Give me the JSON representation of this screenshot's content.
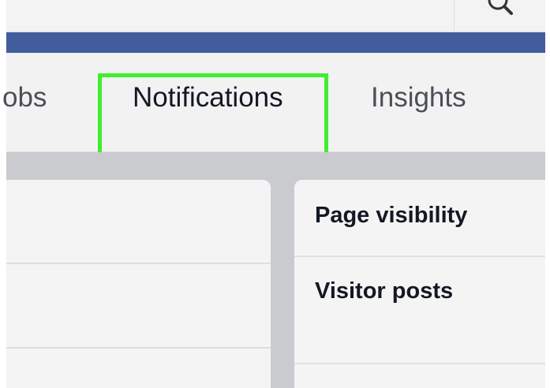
{
  "tabs": {
    "items": [
      {
        "label": "obs"
      },
      {
        "label": "Notifications"
      },
      {
        "label": "Insights"
      }
    ]
  },
  "settings": {
    "rows": [
      {
        "label": "Page visibility"
      },
      {
        "label": "Visitor posts"
      }
    ]
  },
  "icons": {
    "search": "search-icon"
  },
  "colors": {
    "header": "#415d9d",
    "tab_bar": "#f2f2f2",
    "content_background": "#c9cbcf",
    "card_background": "#f4f4f4",
    "highlight": "#3fef2f"
  }
}
